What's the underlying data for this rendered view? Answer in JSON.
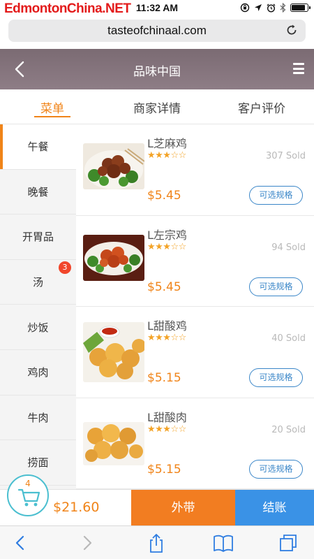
{
  "status_bar": {
    "watermark": "EdmontonChina.NET",
    "carrier": "",
    "time": "11:32 AM",
    "battery_level": 0.9,
    "icons": [
      "lock-rotation-icon",
      "location-icon",
      "alarm-icon",
      "bluetooth-icon",
      "battery-icon"
    ]
  },
  "browser": {
    "url": "tasteofchinaal.com"
  },
  "header": {
    "title": "品味中国"
  },
  "tabs": [
    {
      "label": "菜单",
      "active": true
    },
    {
      "label": "商家详情",
      "active": false
    },
    {
      "label": "客户评价",
      "active": false
    }
  ],
  "categories": [
    {
      "label": "午餐",
      "active": true,
      "badge": ""
    },
    {
      "label": "晚餐",
      "active": false,
      "badge": ""
    },
    {
      "label": "开胃品",
      "active": false,
      "badge": ""
    },
    {
      "label": "汤",
      "active": false,
      "badge": "3"
    },
    {
      "label": "炒饭",
      "active": false,
      "badge": ""
    },
    {
      "label": "鸡肉",
      "active": false,
      "badge": ""
    },
    {
      "label": "牛肉",
      "active": false,
      "badge": ""
    },
    {
      "label": "捞面",
      "active": false,
      "badge": ""
    }
  ],
  "items": [
    {
      "name": "L芝麻鸡",
      "rating": 3,
      "stars": "★★★☆☆",
      "sold": "307 Sold",
      "price": "$5.45",
      "spec_label": "可选规格"
    },
    {
      "name": "L左宗鸡",
      "rating": 3,
      "stars": "★★★☆☆",
      "sold": "94 Sold",
      "price": "$5.45",
      "spec_label": "可选规格"
    },
    {
      "name": "L甜酸鸡",
      "rating": 3,
      "stars": "★★★☆☆",
      "sold": "40 Sold",
      "price": "$5.15",
      "spec_label": "可选规格"
    },
    {
      "name": "L甜酸肉",
      "rating": 3,
      "stars": "★★★☆☆",
      "sold": "20 Sold",
      "price": "$5.15",
      "spec_label": "可选规格"
    }
  ],
  "cart": {
    "count": "4",
    "total": "$21.60",
    "takeout_label": "外带",
    "checkout_label": "结账"
  },
  "colors": {
    "accent": "#f08419",
    "header": "#857580",
    "takeout": "#f27d21",
    "checkout": "#3a92e6",
    "spec_button": "#3a86c8",
    "badge": "#f1462b"
  }
}
